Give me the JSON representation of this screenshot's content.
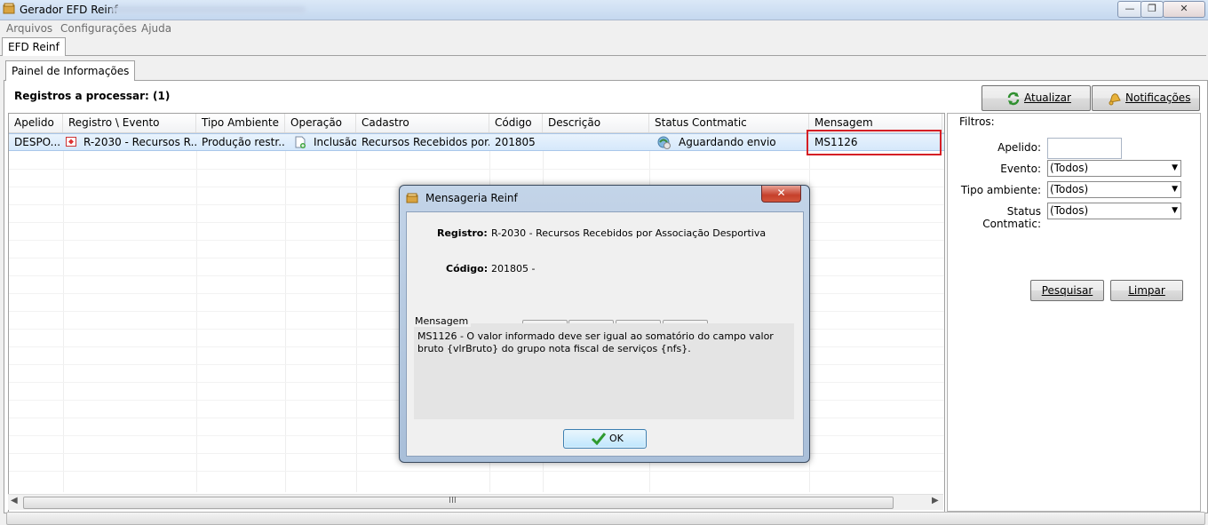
{
  "window": {
    "title": "Gerador EFD Reinf",
    "controls": {
      "minimize": "—",
      "maximize": "❐",
      "close": "✕"
    }
  },
  "menu": [
    "Arquivos",
    "Configurações",
    "Ajuda"
  ],
  "main_tab": "EFD Reinf",
  "sub_tab": "Painel de Informações",
  "registros_label": "Registros a processar: (1)",
  "buttons": {
    "atualizar": "Atualizar",
    "notificacoes": "Notificações"
  },
  "grid": {
    "columns": [
      "Apelido",
      "Registro \\ Evento",
      "Tipo Ambiente",
      "Operação",
      "Cadastro",
      "Código",
      "Descrição",
      "Status Contmatic",
      "Mensagem"
    ],
    "rows": [
      {
        "apelido": "DESPO...",
        "registro": "R-2030 - Recursos R...",
        "tipo_ambiente": "Produção restr...",
        "operacao": "Inclusão",
        "cadastro": "Recursos Recebidos por...",
        "codigo": "201805",
        "descricao": "",
        "status": "Aguardando envio",
        "mensagem": "MS1126"
      }
    ],
    "scroll_mark": "III"
  },
  "filters": {
    "legend": "Filtros:",
    "apelido_label": "Apelido:",
    "apelido_value": "",
    "evento_label": "Evento:",
    "evento_value": "(Todos)",
    "tipo_label": "Tipo ambiente:",
    "tipo_value": "(Todos)",
    "status_label": "Status Contmatic:",
    "status_value": "(Todos)",
    "pesquisar": "Pesquisar",
    "limpar": "Limpar"
  },
  "dialog": {
    "title": "Mensageria Reinf",
    "close": "✕",
    "registro_label": "Registro:",
    "registro_value": "R-2030 - Recursos Recebidos por Associação Desportiva",
    "codigo_label": "Código:",
    "codigo_value": "201805 -",
    "mensagem_legend": "Mensagem",
    "mensagem_text": "MS1126 - O valor informado deve ser igual ao somatório do campo valor bruto {vlrBruto} do grupo nota fiscal de serviços {nfs}.",
    "ok": "OK"
  },
  "colors": {
    "highlight_border": "#d51f25",
    "selected_row": "#d5e8fb",
    "ok_check": "#2e9a2e"
  }
}
